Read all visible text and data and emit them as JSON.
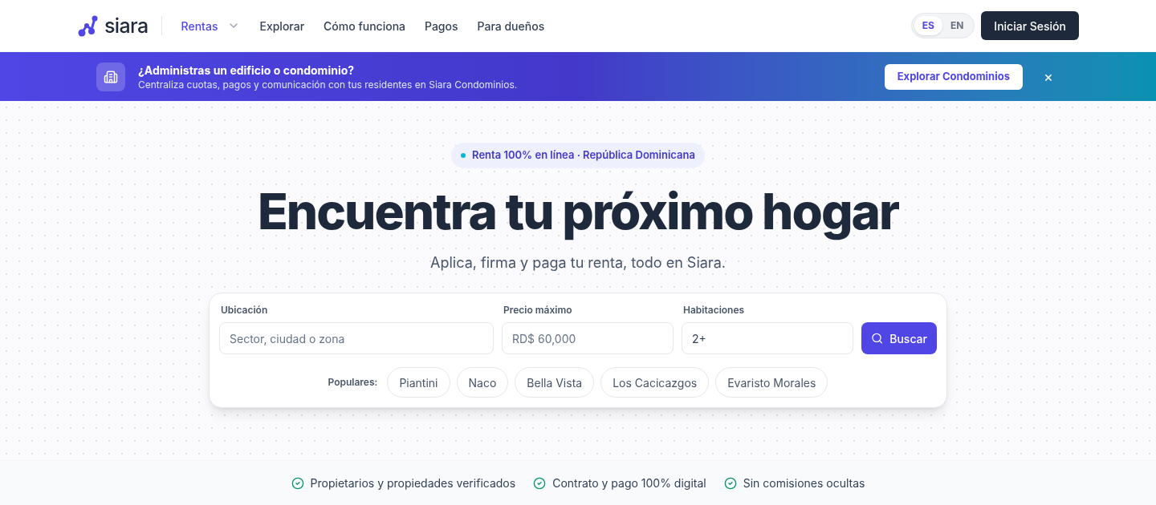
{
  "header": {
    "logo": "siara",
    "nav": [
      {
        "label": "Rentas",
        "selected": true,
        "dropdown": true
      },
      {
        "label": "Explorar",
        "selected": false,
        "dropdown": false
      },
      {
        "label": "Cómo funciona",
        "selected": false,
        "dropdown": false
      },
      {
        "label": "Pagos",
        "selected": false,
        "dropdown": false
      },
      {
        "label": "Para dueños",
        "selected": false,
        "dropdown": false
      }
    ],
    "languages": [
      {
        "label": "ES",
        "selected": true
      },
      {
        "label": "EN",
        "selected": false
      }
    ],
    "login": "Iniciar Sesión"
  },
  "banner": {
    "title": "¿Administras un edificio o condominio?",
    "text": "Centraliza cuotas, pagos y comunicación con tus residentes en Siara Condominios.",
    "button": "Explorar Condominios",
    "close": "×"
  },
  "hero": {
    "badge": "Renta 100% en línea · República Dominicana",
    "title": "Encuentra tu próximo hogar",
    "subtitle": "Aplica, firma y paga tu renta, todo en Siara."
  },
  "search": {
    "fields": [
      {
        "label": "Ubicación",
        "placeholder": "Sector, ciudad o zona"
      },
      {
        "label": "Precio máximo",
        "placeholder": "RD$ 60,000"
      },
      {
        "label": "Habitaciones",
        "value": "2+"
      }
    ],
    "button": "Buscar",
    "popular_label": "Populares:",
    "popular": [
      "Piantini",
      "Naco",
      "Bella Vista",
      "Los Cacicazgos",
      "Evaristo Morales"
    ]
  },
  "features": [
    "Propietarios y propiedades verificados",
    "Contrato y pago 100% digital",
    "Sin comisiones ocultas"
  ]
}
